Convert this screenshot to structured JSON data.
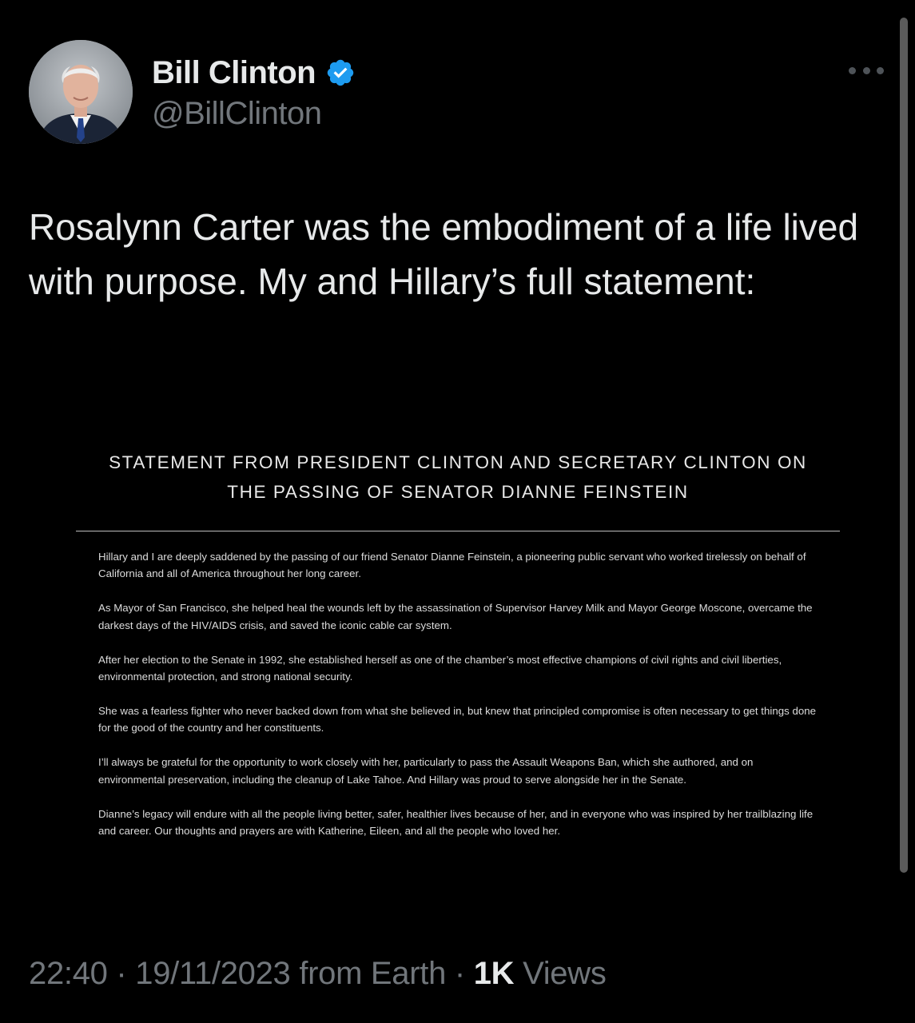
{
  "author": {
    "name": "Bill Clinton",
    "handle": "@BillClinton",
    "verified": true,
    "avatar_icon": "avatar-photo-icon",
    "verified_icon": "verified-badge-icon"
  },
  "menu_icon": "more-options-icon",
  "tweet": {
    "text": "Rosalynn Carter was the embodiment of a life lived with purpose. My and Hillary’s full statement:"
  },
  "statement": {
    "title_line1": "STATEMENT FROM PRESIDENT CLINTON AND SECRETARY CLINTON ON",
    "title_line2": "THE PASSING OF SENATOR DIANNE FEINSTEIN",
    "paragraphs": [
      "Hillary and I are deeply saddened by the passing of our friend Senator Dianne Feinstein, a pioneering public servant who worked tirelessly on behalf of California and all of America throughout her long career.",
      "As Mayor of San Francisco, she helped heal the wounds left by the assassination of Supervisor Harvey Milk and Mayor George Moscone, overcame the darkest days of the HIV/AIDS crisis, and saved the iconic cable car system.",
      "After her election to the Senate in 1992, she established herself as one of the chamber’s most effective champions of civil rights and civil liberties, environmental protection, and strong national security.",
      "She was a fearless fighter who never backed down from what she believed in, but knew that principled compromise is often necessary to get things done for the good of the country and her constituents.",
      "I’ll always be grateful for the opportunity to work closely with her, particularly to pass the Assault Weapons Ban, which she authored, and on environmental preservation, including the cleanup of Lake Tahoe. And Hillary was proud to serve alongside her in the Senate.",
      "Dianne’s legacy will endure with all the people living better, safer, healthier lives because of her, and in everyone who was inspired by her trailblazing life and career. Our thoughts and prayers are with Katherine, Eileen, and all the people who loved her."
    ]
  },
  "footer": {
    "time": "22:40",
    "separator": " · ",
    "date": "19/11/2023",
    "source": " from Earth",
    "views_count": "1K",
    "views_label": " Views"
  },
  "colors": {
    "background": "#000000",
    "text_primary": "#e7e9ea",
    "text_secondary": "#71767b",
    "verified_blue": "#1d9bf0"
  }
}
